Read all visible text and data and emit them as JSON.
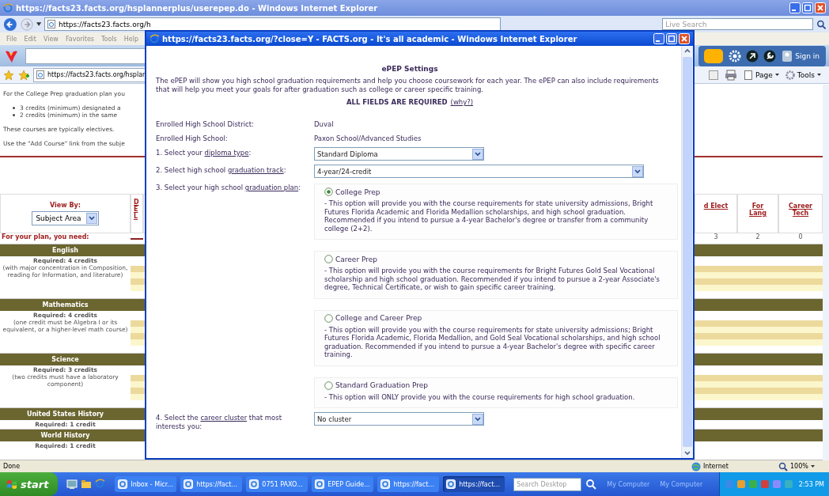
{
  "browser": {
    "title": "https://facts23.facts.org/hsplannerplus/userepep.do - Windows Internet Explorer",
    "address": "https://facts23.facts.org/h",
    "search_placeholder": "Live Search",
    "menu": [
      "File",
      "Edit",
      "View",
      "Favorites",
      "Tools",
      "Help"
    ],
    "sign_in": "Sign in",
    "tab": "https://facts23.facts.org/hsplan",
    "commands": [
      "Page",
      "Tools"
    ],
    "status": "Done",
    "zone": "Internet",
    "zoom": "100%"
  },
  "plan_page": {
    "intro": "For the College Prep graduation plan you",
    "bullets": [
      "3 credits (minimum) designated a",
      "2 credits (minimum) in the same"
    ],
    "note": "These courses are typically electives.",
    "hint": "Use the \"Add Course\" link from the subje",
    "view_by_label": "View By:",
    "view_by_value": "Subject Area",
    "column_2": "DEL",
    "need_label": "For your plan, you need:",
    "right_columns": [
      {
        "label": "d Elect",
        "value": "3"
      },
      {
        "label": "For Lang",
        "value": "2"
      },
      {
        "label": "Career Tech",
        "value": "0"
      }
    ],
    "subjects": [
      {
        "name": "English",
        "required": "Required: 4 credits",
        "detail": "(with major concentration in Composition, reading for Information, and literature)"
      },
      {
        "name": "Mathematics",
        "required": "Required: 4 credits",
        "detail": "(one credit must be Algebra I or its equivalent, or a higher-level math course)"
      },
      {
        "name": "Science",
        "required": "Required: 3 credits",
        "detail": "(two credits must have a laboratory component)"
      },
      {
        "name": "United States History",
        "required": "Required: 1 credit"
      },
      {
        "name": "World History",
        "required": "Required: 1 credit"
      }
    ]
  },
  "popup": {
    "title": "https://facts23.facts.org/?close=Y - FACTS.org - It's all academic - Windows Internet Explorer",
    "heading": "ePEP Settings",
    "intro": "The ePEP will show you high school graduation requirements and help you choose coursework for each year. The ePEP can also include requirements that will help you meet your goals for after graduation such as college or career specific training.",
    "required_notice": "ALL FIELDS ARE REQUIRED",
    "why_link": "(why?)",
    "info": [
      {
        "label": "Enrolled High School District:",
        "value": "Duval"
      },
      {
        "label": "Enrolled High School:",
        "value": "Paxon School/Advanced Studies"
      }
    ],
    "questions": [
      {
        "kind": "select",
        "before": "1. Select your ",
        "link": "diploma type",
        "after": ":",
        "value": "Standard Diploma"
      },
      {
        "kind": "select",
        "before": "2. Select high school ",
        "link": "graduation track",
        "after": ":",
        "value": "4-year/24-credit"
      },
      {
        "kind": "radio",
        "before": "3. Select your high school ",
        "link": "graduation plan",
        "after": ":",
        "options": [
          {
            "label": "College Prep",
            "selected": true,
            "description": "- This option will provide you with the course requirements for state university admissions, Bright Futures Florida Academic and Florida Medallion scholarships, and high school graduation. Recommended if you intend to pursue a 4-year Bachelor's degree or transfer from a community college (2+2)."
          },
          {
            "label": "Career Prep",
            "selected": false,
            "description": "- This option will provide you with the course requirements for Bright Futures Gold Seal Vocational scholarship and high school graduation. Recommended if you intend to pursue a 2-year Associate's degree, Technical Certificate, or wish to gain specific career training."
          },
          {
            "label": "College and Career Prep",
            "selected": false,
            "description": "- This option will provide you with the course requirements for state university admissions; Bright Futures Florida Academic, Florida Medallion, and Gold Seal Vocational scholarships, and high school graduation. Recommended if you intend to pursue a 4-year Bachelor's degree with specific career training."
          },
          {
            "label": "Standard Graduation Prep",
            "selected": false,
            "description": "- This option will ONLY provide you with the course requirements for high school graduation."
          }
        ]
      },
      {
        "kind": "select",
        "before": "4. Select the ",
        "link": "career cluster",
        "after": " that most interests you:",
        "value": "No cluster"
      }
    ]
  },
  "taskbar": {
    "start": "start",
    "tasks": [
      {
        "label": "Inbox - Micr...",
        "selected": false
      },
      {
        "label": "https://fact...",
        "selected": false
      },
      {
        "label": "0751 PAXO...",
        "selected": false
      },
      {
        "label": "EPEP Guide...",
        "selected": false
      },
      {
        "label": "https://fact...",
        "selected": false
      },
      {
        "label": "https://fact...",
        "selected": true
      }
    ],
    "search_placeholder": "Search Desktop",
    "toolbars": [
      "My Computer",
      "My Computer"
    ],
    "clock": "2:53 PM"
  }
}
